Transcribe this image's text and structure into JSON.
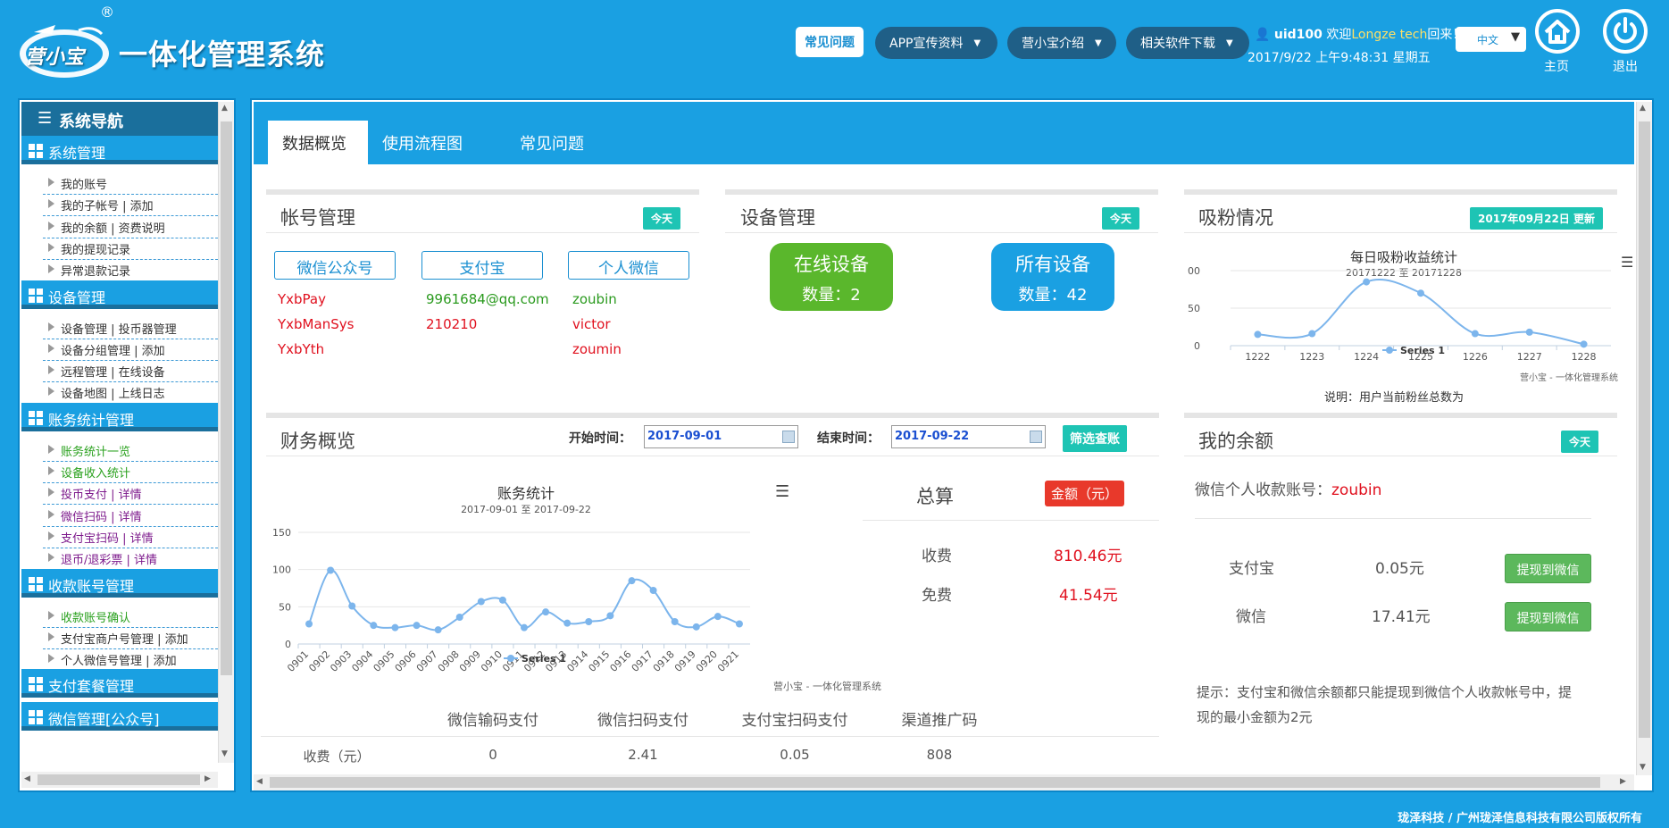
{
  "brand": {
    "logo_text": "一体化管理系统",
    "logo_mark_text": "营小宝",
    "registered": "®"
  },
  "header_nav": {
    "faq": "常见问题",
    "app_promo": "APP宣传资料",
    "about": "营小宝介绍",
    "downloads": "相关软件下载"
  },
  "user": {
    "name": "uid100",
    "welcome": "欢迎",
    "org": "Longze tech",
    "back": "回来！",
    "datetime": "2017/9/22 上午9:48:31 星期五"
  },
  "language": {
    "selected": "中文"
  },
  "home_label": "主页",
  "logout_label": "退出",
  "sidebar": {
    "title": "系统导航",
    "groups": [
      {
        "label": "系统管理",
        "items": [
          {
            "label": "我的账号"
          },
          {
            "label": "我的子帐号 | 添加"
          },
          {
            "label": "我的余额 | 资费说明"
          },
          {
            "label": "我的提现记录"
          },
          {
            "label": "异常退款记录"
          }
        ]
      },
      {
        "label": "设备管理",
        "items": [
          {
            "label": "设备管理 | 投币器管理"
          },
          {
            "label": "设备分组管理 | 添加"
          },
          {
            "label": "远程管理 | 在线设备"
          },
          {
            "label": "设备地图 | 上线日志"
          }
        ]
      },
      {
        "label": "账务统计管理",
        "items": [
          {
            "label": "账务统计一览"
          },
          {
            "label": "设备收入统计"
          },
          {
            "label": "投币支付 | 详情"
          },
          {
            "label": "微信扫码 | 详情"
          },
          {
            "label": "支付宝扫码 | 详情"
          },
          {
            "label": "退币/退彩票 | 详情"
          }
        ]
      },
      {
        "label": "收款账号管理",
        "items": [
          {
            "label": "收款账号确认"
          },
          {
            "label": "支付宝商户号管理 | 添加"
          },
          {
            "label": "个人微信号管理 | 添加"
          }
        ]
      },
      {
        "label": "支付套餐管理",
        "items": []
      },
      {
        "label": "微信管理[公众号]",
        "items": []
      }
    ]
  },
  "tabs": [
    {
      "label": "数据概览"
    },
    {
      "label": "使用流程图"
    },
    {
      "label": "常见问题"
    }
  ],
  "account_panel": {
    "title": "帐号管理",
    "badge": "今天",
    "columns": [
      {
        "header": "微信公众号",
        "values": [
          "YxbPay",
          "YxbManSys",
          "YxbYth"
        ]
      },
      {
        "header": "支付宝",
        "values": [
          "9961684@qq.com",
          "210210"
        ]
      },
      {
        "header": "个人微信",
        "values": [
          "zoubin",
          "victor",
          "zoumin"
        ]
      }
    ]
  },
  "device_panel": {
    "title": "设备管理",
    "badge": "今天",
    "online": {
      "title": "在线设备",
      "count_text": "数量：2"
    },
    "all": {
      "title": "所有设备",
      "count_text": "数量：42"
    }
  },
  "fans_panel": {
    "title": "吸粉情况",
    "badge": "2017年09月22日 更新",
    "note": "说明：用户当前粉丝总数为",
    "credit": "营小宝 - 一体化管理系统"
  },
  "finance_panel": {
    "title": "财务概览",
    "start_label": "开始时间：",
    "start_value": "2017-09-01",
    "end_label": "结束时间：",
    "end_value": "2017-09-22",
    "filter_btn": "筛选查账",
    "credit": "营小宝 - 一体化管理系统",
    "total": {
      "title": "总算",
      "badge": "金额（元）",
      "rows": [
        {
          "label": "收费",
          "value": "810.46元"
        },
        {
          "label": "免费",
          "value": "41.54元"
        }
      ]
    },
    "table": {
      "headers": [
        "微信输码支付",
        "微信扫码支付",
        "支付宝扫码支付",
        "渠道推广码"
      ],
      "row_label": "收费（元）",
      "values": [
        "0",
        "2.41",
        "0.05",
        "808"
      ]
    }
  },
  "balance_panel": {
    "title": "我的余额",
    "badge": "今天",
    "account_label": "微信个人收款账号：",
    "account_value": "zoubin",
    "rows": [
      {
        "label": "支付宝",
        "value": "0.05元",
        "button": "提现到微信"
      },
      {
        "label": "微信",
        "value": "17.41元",
        "button": "提现到微信"
      }
    ],
    "hint_line1": "提示：支付宝和微信余额都只能提现到微信个人收款帐号中，提",
    "hint_line2": "现的最小金额为2元"
  },
  "footer": "珑泽科技 / 广州珑泽信息科技有限公司版权所有",
  "colors": {
    "header_bg": "#1aa0e2",
    "accent_teal": "#1ec4b4",
    "red": "#e0101e",
    "series": "#7cb5ec"
  },
  "chart_data": [
    {
      "type": "line",
      "title": "每日吸粉收益统计",
      "subtitle": "20171222 至 20171228",
      "categories": [
        "1222",
        "1223",
        "1224",
        "1225",
        "1226",
        "1227",
        "1228"
      ],
      "series": [
        {
          "name": "Series 1",
          "values": [
            15,
            16,
            85,
            70,
            16,
            18,
            2
          ]
        }
      ],
      "yticks": [
        "0",
        "50",
        "00"
      ],
      "ylim": [
        0,
        100
      ],
      "legend": "bottom-center"
    },
    {
      "type": "line",
      "title": "账务统计",
      "subtitle": "2017-09-01 至 2017-09-22",
      "categories": [
        "0901",
        "0902",
        "0903",
        "0904",
        "0905",
        "0906",
        "0907",
        "0908",
        "0909",
        "0910",
        "0911",
        "0912",
        "0913",
        "0914",
        "0915",
        "0916",
        "0917",
        "0918",
        "0919",
        "0920",
        "0921"
      ],
      "series": [
        {
          "name": "Series 1",
          "values": [
            27,
            99,
            51,
            25,
            22,
            25,
            19,
            36,
            57,
            59,
            22,
            43,
            28,
            30,
            38,
            85,
            72,
            30,
            23,
            37,
            27
          ]
        }
      ],
      "yticks": [
        "0",
        "50",
        "100",
        "150"
      ],
      "ylim": [
        0,
        150
      ],
      "legend": "bottom-center"
    }
  ]
}
